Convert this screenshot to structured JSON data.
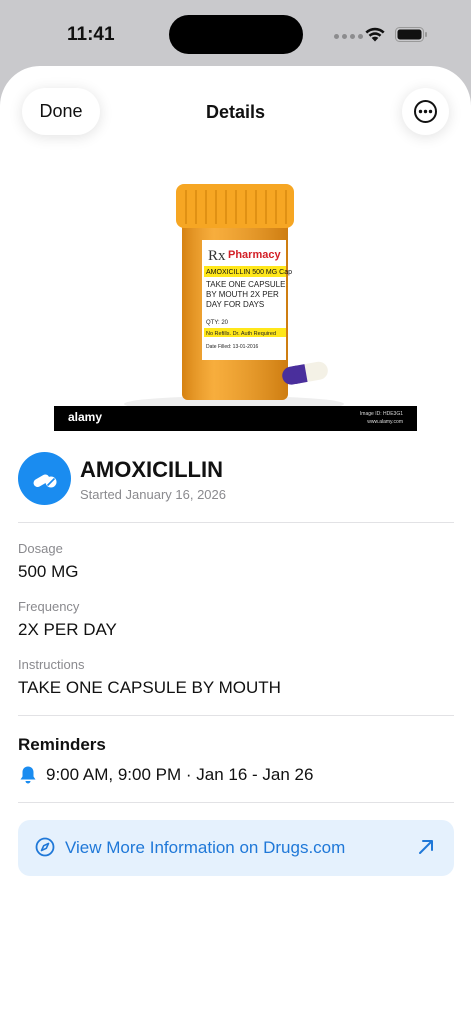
{
  "status": {
    "time": "11:41"
  },
  "nav": {
    "done_label": "Done",
    "title": "Details"
  },
  "photo": {
    "label_pharmacy": "Pharmacy",
    "label_rx": "Rx",
    "label_drug": "AMOXICILLIN 500 MG Cap",
    "label_instructions": "TAKE ONE CAPSULE BY MOUTH 2X PER DAY FOR DAYS",
    "label_qty": "QTY: 20",
    "label_refills": "No Refills.  Dr. Auth Required",
    "label_date": "Date Filled: 13-01-2016",
    "watermark": "alamy",
    "watermark_id": "Image ID: HDE3G1",
    "watermark_url": "www.alamy.com"
  },
  "drug": {
    "name": "AMOXICILLIN",
    "started": "Started January 16, 2026"
  },
  "fields": {
    "dosage_label": "Dosage",
    "dosage_value": "500 MG",
    "frequency_label": "Frequency",
    "frequency_value": "2X PER DAY",
    "instructions_label": "Instructions",
    "instructions_value": "TAKE ONE CAPSULE BY MOUTH"
  },
  "reminders": {
    "title": "Reminders",
    "schedule": "9:00 AM, 9:00 PM · Jan 16 - Jan 26"
  },
  "link": {
    "label": "View More Information on Drugs.com"
  },
  "colors": {
    "accent": "#1a8cf0",
    "link_text": "#1f78d8",
    "link_bg": "#e5f1fd",
    "bottle": "#f39a1c",
    "cap": "#f6a623"
  },
  "icons": [
    "ellipsis-circle-icon",
    "pills-icon",
    "bell-icon",
    "compass-icon",
    "arrow-up-right-icon",
    "wifi-icon",
    "battery-icon"
  ]
}
